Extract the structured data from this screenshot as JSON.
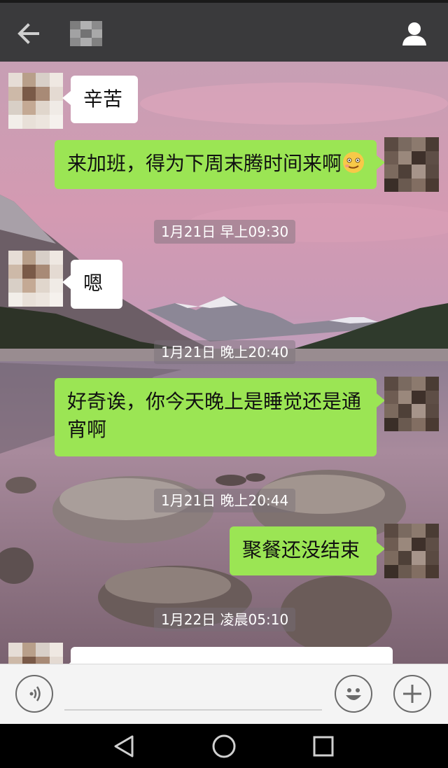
{
  "header": {
    "back_icon": "arrow-left-icon",
    "profile_icon": "person-icon"
  },
  "messages": [
    {
      "side": "left",
      "text": "辛苦"
    },
    {
      "side": "right",
      "text": "来加班，得为下周末腾时间来啊"
    },
    {
      "side": "left",
      "text": "嗯"
    },
    {
      "side": "right",
      "text": "好奇诶，你今天晚上是睡觉还是通宵啊"
    },
    {
      "side": "right",
      "text": "聚餐还没结束"
    }
  ],
  "timestamps": [
    "1月21日 早上09:30",
    "1月21日 晚上20:40",
    "1月21日 晚上20:44",
    "1月22日 凌晨05:10"
  ],
  "input": {
    "voice_icon": "voice-icon",
    "emoji_icon": "smiley-icon",
    "add_icon": "plus-icon"
  },
  "colors": {
    "header_bg": "#3a3a3c",
    "sent_bubble": "#9be554",
    "received_bubble": "#ffffff"
  }
}
